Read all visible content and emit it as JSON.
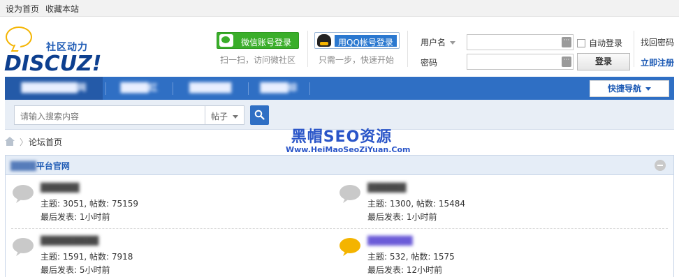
{
  "topbar": {
    "set_home": "设为首页",
    "bookmark": "收藏本站"
  },
  "logo": {
    "cn": "社区动力",
    "en": "DISCUZ!"
  },
  "social": {
    "wechat_label": "微信账号登录",
    "wechat_sub": "扫一扫，访问微社区",
    "qq_label": "用QQ帐号登录",
    "qq_sub": "只需一步，快速开始"
  },
  "login": {
    "username_label": "用户名",
    "password_label": "密码",
    "auto_login": "自动登录",
    "login_button": "登录",
    "find_password": "找回密码",
    "register": "立即注册"
  },
  "nav": {
    "items": [
      {
        "label": "████████网"
      },
      {
        "label": "████红"
      },
      {
        "label": "██████"
      },
      {
        "label": "████综"
      }
    ],
    "quick_nav": "快捷导航"
  },
  "search": {
    "placeholder": "请输入搜索内容",
    "type": "帖子"
  },
  "breadcrumb": {
    "label": "论坛首页"
  },
  "watermark": {
    "title": "黑帽SEO资源",
    "url": "Www.HeiMaoSeoZiYuan.Com"
  },
  "section": {
    "title_blurred": "████",
    "title_tail": "平台官网",
    "forums": [
      {
        "name": "██████",
        "stats": "主题: 3051, 帖数: 75159",
        "last": "最后发表: 1小时前",
        "icon": "forum-bubble-gray"
      },
      {
        "name": "██████",
        "stats": "主题: 1300, 帖数: 15484",
        "last": "最后发表: 1小时前",
        "icon": "forum-bubble-gray"
      },
      {
        "name": "█████████",
        "stats": "主题: 1591, 帖数: 7918",
        "last": "最后发表: 5小时前",
        "icon": "forum-bubble-gray"
      },
      {
        "name": "███████",
        "stats": "主题: 532, 帖数: 1575",
        "last": "最后发表: 12小时前",
        "icon": "forum-bubble-new"
      }
    ]
  },
  "colors": {
    "nav_bg": "#2f6fc4",
    "wechat": "#3aae2a",
    "new_forum": "#f4b400"
  }
}
